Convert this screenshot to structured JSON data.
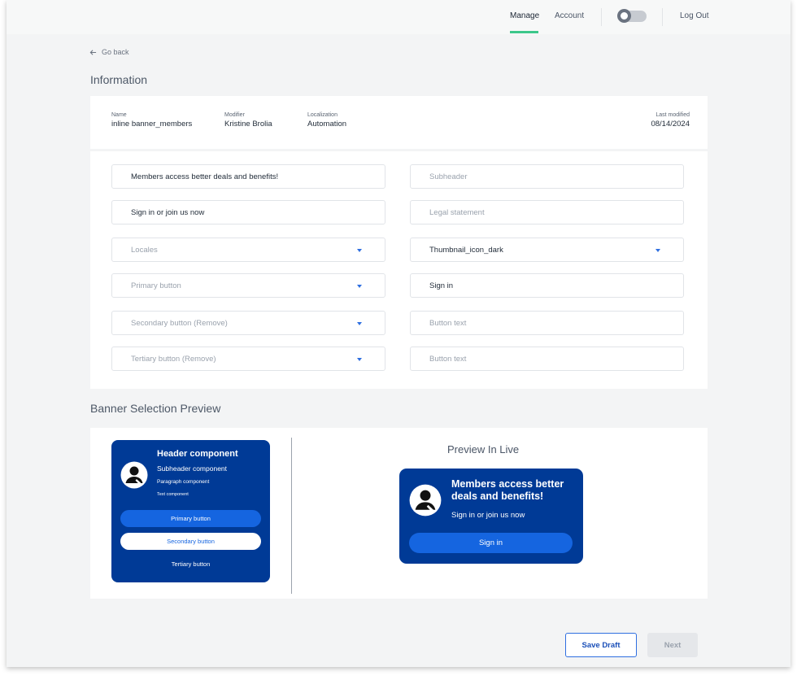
{
  "nav": {
    "manage": "Manage",
    "account": "Account",
    "logout": "Log Out",
    "theme_toggle_on": false
  },
  "go_back": "Go back",
  "information": {
    "title": "Information",
    "name_label": "Name",
    "name_value": "inline banner_members",
    "modifier_label": "Modifier",
    "modifier_value": "Kristine Brolia",
    "localization_label": "Localization",
    "localization_value": "Automation",
    "last_modified_label": "Last modified",
    "last_modified_value": "08/14/2024"
  },
  "form": {
    "header_value": "Members access better deals and benefits!",
    "subheader_placeholder": "Subheader",
    "paragraph_value": "Sign in or join us now",
    "legal_placeholder": "Legal statement",
    "locales_placeholder": "Locales",
    "thumbnail_value": "Thumbnail_icon_dark",
    "primary_button_placeholder": "Primary button",
    "primary_button_text": "Sign in",
    "secondary_button_placeholder": "Secondary button  (Remove)",
    "secondary_button_text_placeholder": "Button text",
    "tertiary_button_placeholder": "Tertiary button   (Remove)",
    "tertiary_button_text_placeholder": "Button text"
  },
  "preview": {
    "title": "Banner Selection Preview",
    "template": {
      "header": "Header component",
      "subheader": "Subheader component",
      "paragraph": "Paragraph component",
      "text": "Text component",
      "primary": "Primary button",
      "secondary": "Secondary button",
      "tertiary": "Tertiary button"
    },
    "live": {
      "title": "Preview In Live",
      "header": "Members access better deals and benefits!",
      "subheader": "Sign in or join us now",
      "button": "Sign in"
    }
  },
  "actions": {
    "save_draft": "Save Draft",
    "next": "Next"
  },
  "colors": {
    "accent": "#2f6fe0",
    "nav_underline": "#3cc78a",
    "banner_bg": "#003a96",
    "banner_button": "#1565e0"
  }
}
